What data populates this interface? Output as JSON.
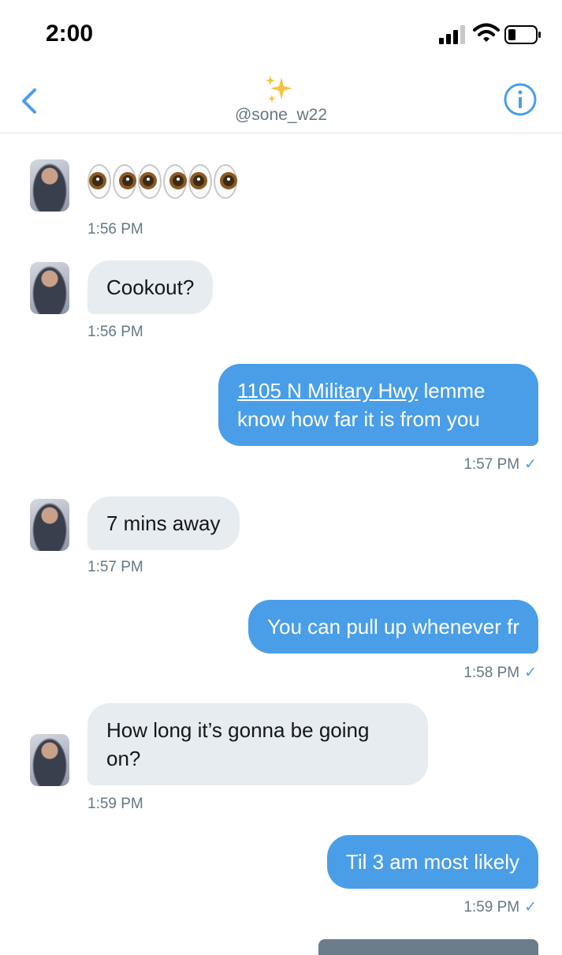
{
  "status_bar": {
    "time": "2:00"
  },
  "header": {
    "emoji": "✨",
    "handle": "@sone_w22"
  },
  "messages": [
    {
      "text": "👀👀👀👀👀👀",
      "time": "1:56 PM"
    },
    {
      "text": "Cookout?",
      "time": "1:56 PM"
    },
    {
      "link": "1105 N Military Hwy",
      "text": " lemme know how far it is from you",
      "time": "1:57 PM",
      "check": "✓"
    },
    {
      "text": "7 mins away",
      "time": "1:57 PM"
    },
    {
      "text": "You can pull up whenever fr",
      "time": "1:58 PM",
      "check": "✓"
    },
    {
      "text": "How long it’s gonna be going on?",
      "time": "1:59 PM"
    },
    {
      "text": "Til 3 am most likely",
      "time": "1:59 PM",
      "check": "✓"
    }
  ],
  "icons": [
    "signal-icon",
    "wifi-icon",
    "battery-icon",
    "back-chevron-icon",
    "sparkles-icon",
    "info-icon",
    "read-check-icon"
  ],
  "colors": {
    "accent": "#4a9ee8",
    "incoming_bubble": "#e6ecf0",
    "timestamp": "#657786"
  }
}
